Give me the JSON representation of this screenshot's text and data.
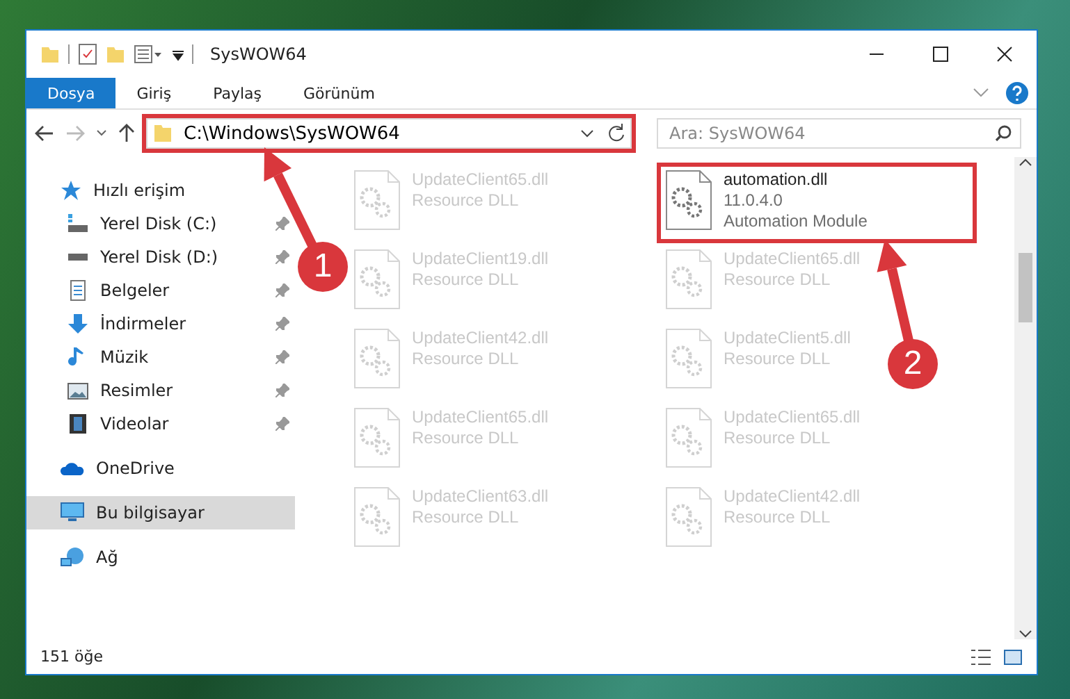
{
  "window": {
    "title": "SysWOW64"
  },
  "ribbon": {
    "tabs": [
      {
        "label": "Dosya",
        "selected": true
      },
      {
        "label": "Giriş",
        "selected": false
      },
      {
        "label": "Paylaş",
        "selected": false
      },
      {
        "label": "Görünüm",
        "selected": false
      }
    ]
  },
  "address_bar": {
    "path": "C:\\Windows\\SysWOW64",
    "highlighted": true
  },
  "search": {
    "placeholder": "Ara: SysWOW64"
  },
  "sidebar": {
    "items": [
      {
        "label": "Hızlı erişim",
        "kind": "star",
        "pinned": false,
        "selected": false,
        "children": [
          {
            "label": "Yerel Disk (C:)",
            "kind": "system-drive",
            "pinned": true,
            "selected": false
          },
          {
            "label": "Yerel Disk (D:)",
            "kind": "drive",
            "pinned": true,
            "selected": false
          },
          {
            "label": "Belgeler",
            "kind": "document",
            "pinned": true,
            "selected": false
          },
          {
            "label": "İndirmeler",
            "kind": "download",
            "pinned": true,
            "selected": false
          },
          {
            "label": "Müzik",
            "kind": "music",
            "pinned": true,
            "selected": false
          },
          {
            "label": "Resimler",
            "kind": "picture",
            "pinned": true,
            "selected": false
          },
          {
            "label": "Videolar",
            "kind": "video",
            "pinned": true,
            "selected": false
          }
        ]
      },
      {
        "label": "OneDrive",
        "kind": "cloud",
        "pinned": false,
        "selected": false
      },
      {
        "label": "Bu bilgisayar",
        "kind": "computer",
        "pinned": false,
        "selected": true
      },
      {
        "label": "Ağ",
        "kind": "network",
        "pinned": false,
        "selected": false
      }
    ]
  },
  "files": [
    {
      "name": "UpdateClient65.dll",
      "details": [
        "Resource DLL"
      ],
      "faded": true,
      "highlighted": false
    },
    {
      "name": "automation.dll",
      "details": [
        "11.0.4.0",
        "Automation Module"
      ],
      "faded": false,
      "highlighted": true
    },
    {
      "name": "UpdateClient19.dll",
      "details": [
        "Resource DLL"
      ],
      "faded": true,
      "highlighted": false
    },
    {
      "name": "UpdateClient65.dll",
      "details": [
        "Resource DLL"
      ],
      "faded": true,
      "highlighted": false
    },
    {
      "name": "UpdateClient42.dll",
      "details": [
        "Resource DLL"
      ],
      "faded": true,
      "highlighted": false
    },
    {
      "name": "UpdateClient5.dll",
      "details": [
        "Resource DLL"
      ],
      "faded": true,
      "highlighted": false
    },
    {
      "name": "UpdateClient65.dll",
      "details": [
        "Resource DLL"
      ],
      "faded": true,
      "highlighted": false
    },
    {
      "name": "UpdateClient65.dll",
      "details": [
        "Resource DLL"
      ],
      "faded": true,
      "highlighted": false
    },
    {
      "name": "UpdateClient63.dll",
      "details": [
        "Resource DLL"
      ],
      "faded": true,
      "highlighted": false
    },
    {
      "name": "UpdateClient42.dll",
      "details": [
        "Resource DLL"
      ],
      "faded": true,
      "highlighted": false
    }
  ],
  "status_bar": {
    "item_count": "151 öğe"
  },
  "callouts": [
    {
      "number": "1"
    },
    {
      "number": "2"
    }
  ]
}
